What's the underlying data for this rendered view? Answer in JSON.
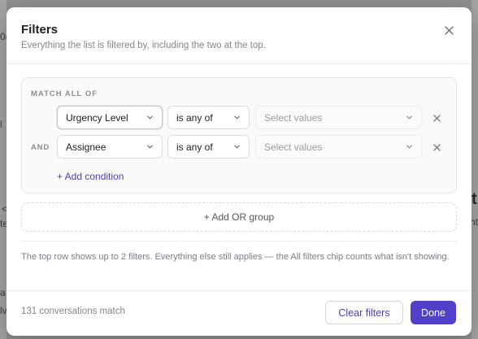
{
  "background": {
    "fragments": [
      "0(",
      "l",
      "<",
      "te",
      "a",
      "lv",
      "t",
      "ht"
    ]
  },
  "modal": {
    "title": "Filters",
    "subtitle": "Everything the list is filtered by, including the two at the top.",
    "close_icon": "close-icon"
  },
  "group": {
    "match_label": "MATCH ALL OF",
    "rows": [
      {
        "connector": "",
        "field": "Urgency Level",
        "operator": "is any of",
        "values_placeholder": "Select values"
      },
      {
        "connector": "AND",
        "field": "Assignee",
        "operator": "is any of",
        "values_placeholder": "Select values"
      }
    ],
    "add_condition": "+ Add condition"
  },
  "add_or_group": "+ Add OR group",
  "note": "The top row shows up to 2 filters. Everything else still applies — the All filters chip counts what isn't showing.",
  "footer": {
    "count": "131 conversations match",
    "clear_label": "Clear filters",
    "done_label": "Done"
  },
  "colors": {
    "accent": "#5140c9",
    "link": "#4b3fb8"
  }
}
